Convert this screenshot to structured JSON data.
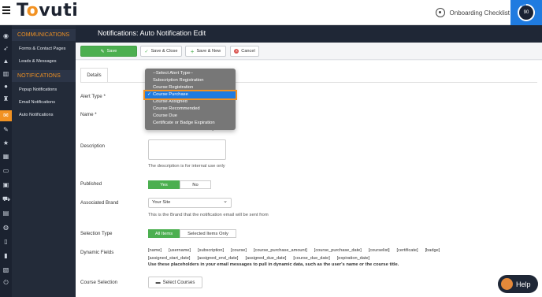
{
  "brand": {
    "logo": "Tovuti",
    "accent": "#f29222",
    "primary": "#1f7be0"
  },
  "header": {
    "onboarding_label": "Onboarding Checklist",
    "progress": "90"
  },
  "sidebar": {
    "sections": [
      {
        "title": "COMMUNICATIONS",
        "items": [
          "Forms & Contact Pages",
          "Leads & Messages"
        ]
      },
      {
        "title": "NOTIFICATIONS",
        "items": [
          "Popup Notifications",
          "Email Notifications",
          "Auto Notifications"
        ]
      }
    ]
  },
  "page": {
    "title": "Notifications: Auto Notification Edit"
  },
  "toolbar": {
    "save": "Save",
    "save_close": "Save & Close",
    "save_new": "Save & New",
    "cancel": "Cancel"
  },
  "tabs": {
    "details": "Details"
  },
  "form": {
    "alert_type_label": "Alert Type *",
    "name_label": "Name *",
    "name_help": "The name is for internal use only",
    "description_label": "Description",
    "description_help": "The description is for internal use only",
    "published_label": "Published",
    "published_yes": "Yes",
    "published_no": "No",
    "brand_label": "Associated Brand",
    "brand_value": "Your Site",
    "brand_help": "This is the Brand that the notification email will be sent from",
    "selection_label": "Selection Type",
    "selection_all": "All Items",
    "selection_selected": "Selected Items Only",
    "dynamic_label": "Dynamic Fields",
    "placeholders_row1": [
      "[name]",
      "[username]",
      "[subscription]",
      "[course]",
      "[course_purchase_amount]",
      "[course_purchase_date]",
      "[courselist]",
      "[certificate]",
      "[badge]"
    ],
    "placeholders_row2": [
      "[assigned_start_date]",
      "[assigned_end_date]",
      "[assigned_due_date]",
      "[course_due_date]",
      "[expiration_date]"
    ],
    "placeholders_note": "Use these placeholders in your email messages to pull in dynamic data, such as the user's name or the course title.",
    "course_selection_label": "Course Selection",
    "select_courses": "Select Courses"
  },
  "dropdown": {
    "options": [
      "--Select Alert Type--",
      "Subscription Registration",
      "Course Registration",
      "Course Purchase",
      "Course Assigned",
      "Course Recommended",
      "Course Due",
      "Certificate or Badge Expiration"
    ],
    "selected_index": 3
  },
  "help_button": "Help"
}
